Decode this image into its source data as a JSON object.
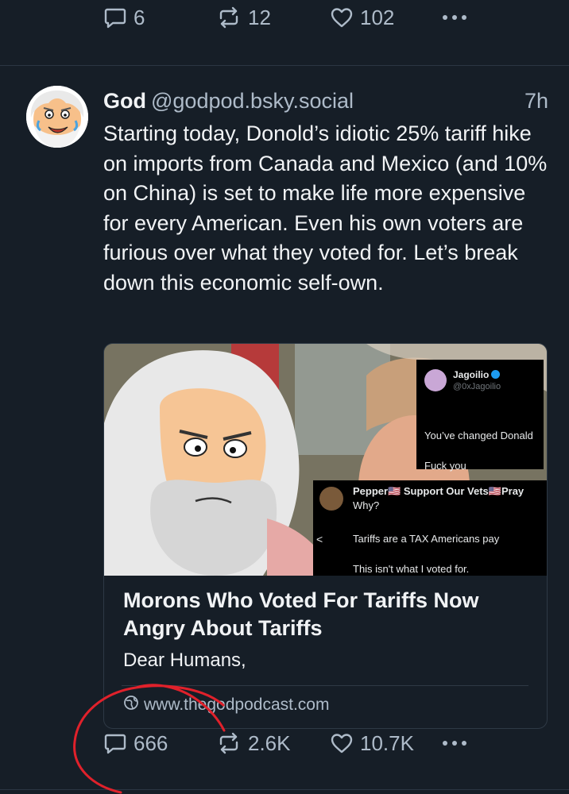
{
  "previous_post": {
    "reply_count": "6",
    "repost_count": "12",
    "like_count": "102"
  },
  "post": {
    "display_name": "God",
    "handle": "@godpod.bsky.social",
    "time": "7h",
    "text": "Starting today, Donold’s idiotic 25% tariff hike on imports from Canada and Mexico (and 10% on China) is set to make life more expensive for every American. Even his own voters are furious over what they voted for. Let’s break down this economic self-own.",
    "reply_count": "666",
    "repost_count": "2.6K",
    "like_count": "10.7K"
  },
  "card": {
    "title": "Morons Who Voted For Tariffs Now Angry About Tariffs",
    "description": "Dear Humans,",
    "url": "www.thegodpodcast.com",
    "embedded_tweet_1": {
      "name": "Jagoilio",
      "handle": "@0xJagoilio",
      "line1": "You’ve changed Donald",
      "line2": "Fuck you"
    },
    "embedded_tweet_2": {
      "name": "Pepper🇺🇸 Support Our Vets🇺🇸Pray",
      "line0": "Why?",
      "back": "<",
      "line1": "Tariffs are a TAX Americans pay",
      "line2": "This isn't what I voted for."
    }
  },
  "colors": {
    "background": "#161e27",
    "text": "#f1f3f5",
    "muted": "#aebbc9",
    "annotation": "#e0212b"
  },
  "icons": [
    "reply-icon",
    "repost-icon",
    "like-icon",
    "more-icon",
    "globe-icon"
  ]
}
